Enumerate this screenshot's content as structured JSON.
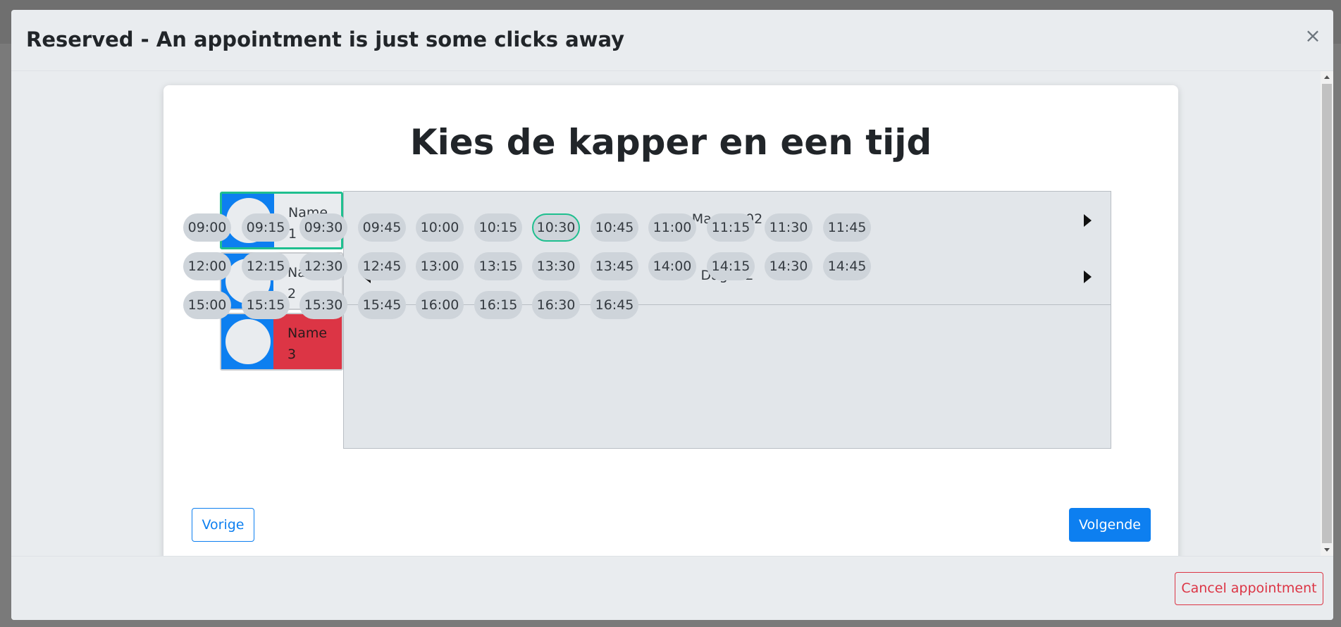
{
  "modal": {
    "title": "Reserved - An appointment is just some clicks away",
    "close_symbol": "×"
  },
  "card": {
    "title": "Kies de kapper en een tijd"
  },
  "barbers": [
    {
      "name": "Name 1",
      "state": "selected"
    },
    {
      "name": "Name 2",
      "state": "available"
    },
    {
      "name": "Name 3",
      "state": "unavailable"
    }
  ],
  "calendar": {
    "month_label": "Maand: 02",
    "day_label": "Dag: 02"
  },
  "time_slots": [
    "09:00",
    "09:15",
    "09:30",
    "09:45",
    "10:00",
    "10:15",
    "10:30",
    "10:45",
    "11:00",
    "11:15",
    "11:30",
    "11:45",
    "12:00",
    "12:15",
    "12:30",
    "12:45",
    "13:00",
    "13:15",
    "13:30",
    "13:45",
    "14:00",
    "14:15",
    "14:30",
    "14:45",
    "15:00",
    "15:15",
    "15:30",
    "15:45",
    "16:00",
    "16:15",
    "16:30",
    "16:45"
  ],
  "selected_slot": "10:30",
  "buttons": {
    "prev": "Vorige",
    "next": "Volgende",
    "cancel": "Cancel appointment"
  },
  "colors": {
    "primary": "#0d7ff0",
    "selected_outline": "#1fbf8f",
    "danger": "#dc3545",
    "slot_bg": "#ced4da"
  }
}
